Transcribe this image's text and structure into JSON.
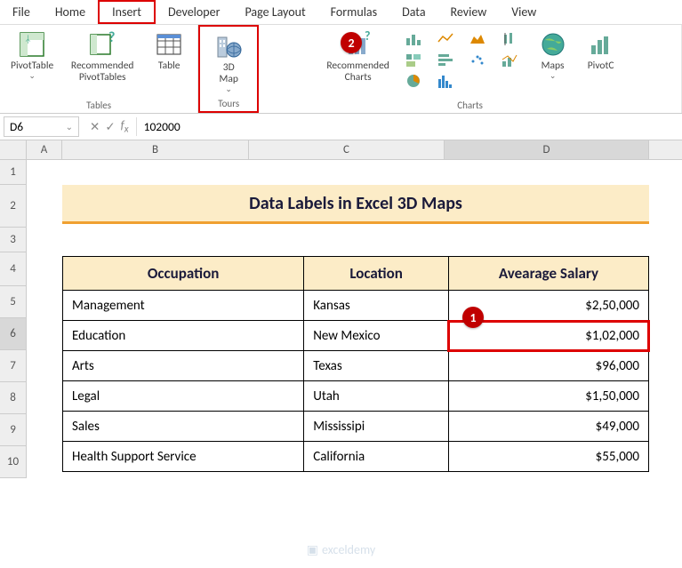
{
  "menu": {
    "items": [
      "File",
      "Home",
      "Insert",
      "Developer",
      "Page Layout",
      "Formulas",
      "Data",
      "Review",
      "View"
    ],
    "active": "Insert"
  },
  "ribbon": {
    "tables": {
      "pivotTable": "PivotTable",
      "recommended": "Recommended\nPivotTables",
      "table": "Table",
      "groupLabel": "Tables"
    },
    "tours": {
      "map3d": "3D\nMap",
      "groupLabel": "Tours"
    },
    "charts": {
      "recommended": "Recommended\nCharts",
      "maps": "Maps",
      "pivotChart": "PivotC",
      "groupLabel": "Charts"
    }
  },
  "formulaBar": {
    "nameBox": "D6",
    "value": "102000"
  },
  "columns": [
    "A",
    "B",
    "C",
    "D"
  ],
  "rows": [
    "1",
    "2",
    "3",
    "4",
    "5",
    "6",
    "7",
    "8",
    "9",
    "10"
  ],
  "dataTitle": "Data Labels in Excel 3D Maps",
  "tableHeaders": [
    "Occupation",
    "Location",
    "Avearage Salary"
  ],
  "tableRows": [
    {
      "occ": "Management",
      "loc": "Kansas",
      "sal": "$2,50,000"
    },
    {
      "occ": "Education",
      "loc": "New Mexico",
      "sal": "$1,02,000"
    },
    {
      "occ": "Arts",
      "loc": "Texas",
      "sal": "$96,000"
    },
    {
      "occ": "Legal",
      "loc": "Utah",
      "sal": "$1,50,000"
    },
    {
      "occ": "Sales",
      "loc": "Mississipi",
      "sal": "$49,000"
    },
    {
      "occ": "Health Support Service",
      "loc": "California",
      "sal": "$55,000"
    }
  ],
  "callouts": {
    "c1": "1",
    "c2": "2"
  },
  "watermark": "exceldemy"
}
